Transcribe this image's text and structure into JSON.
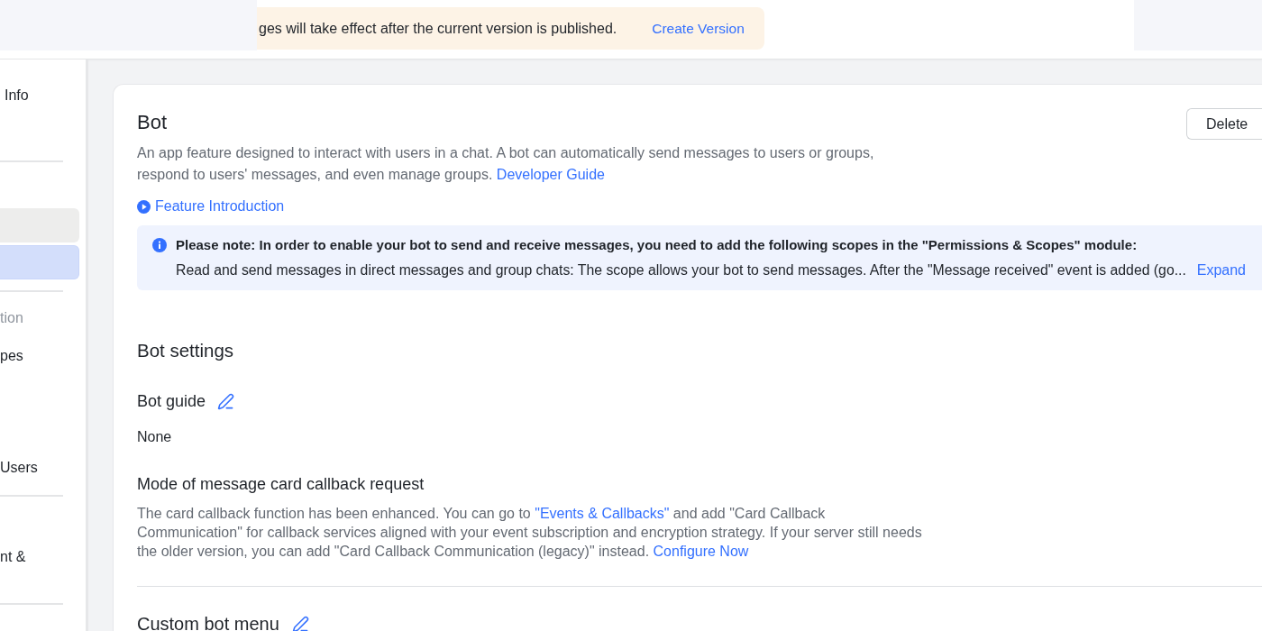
{
  "header": {
    "banner": {
      "text": "ges will take effect after the current version is published.",
      "action": "Create Version"
    }
  },
  "sidebar": {
    "groups": [
      {
        "items": [
          {
            "kind": "item",
            "label": "Info",
            "selected": false,
            "hovered": false
          }
        ]
      },
      {
        "items": [
          {
            "kind": "item",
            "selected": false,
            "hovered": true
          },
          {
            "kind": "item",
            "selected": true,
            "hovered": false
          }
        ]
      },
      {
        "items": [
          {
            "kind": "heading",
            "label": "tion"
          },
          {
            "kind": "item",
            "label": "pes",
            "selected": false,
            "hovered": false
          },
          {
            "kind": "item",
            "label": "Users",
            "selected": false,
            "hovered": false
          }
        ]
      },
      {
        "items": [
          {
            "kind": "item",
            "label": "nt &",
            "selected": false,
            "hovered": false
          }
        ]
      }
    ]
  },
  "feature": {
    "title": "Bot",
    "delete_button": "Delete",
    "description": {
      "text": "An app feature designed to interact with users in a chat. A bot can automatically send messages to users or groups, respond to users' messages, and even manage groups.",
      "link": "Developer Guide"
    },
    "intro_link": "Feature Introduction",
    "notice": {
      "title": "Please note: In order to enable your bot to send and receive messages, you need to add the following scopes in the \"Permissions & Scopes\" module:",
      "detail": "Read and send messages in direct messages and group chats: The scope allows your bot to send messages. After the \"Message received\" event is added (go...",
      "action": "Expand"
    }
  },
  "settings": {
    "title": "Bot settings",
    "fields": [
      {
        "label": "Bot guide",
        "editable": true,
        "parts": [
          {
            "kind": "value",
            "text": "None"
          }
        ]
      },
      {
        "label": "Mode of message card callback request",
        "editable": false,
        "parts": [
          {
            "kind": "text",
            "text": "The card callback function has been enhanced. You can go to "
          },
          {
            "kind": "link",
            "text": "\"Events & Callbacks\""
          },
          {
            "kind": "text",
            "text": " and add \"Card Callback Communication\" for callback services aligned with your event subscription and encryption strategy. If your server still needs the older version, you can add \"Card Callback Communication (legacy)\" instead. "
          },
          {
            "kind": "link",
            "text": "Configure Now"
          }
        ]
      }
    ]
  },
  "custom_menu": {
    "title": "Custom bot menu",
    "editable": true
  }
}
